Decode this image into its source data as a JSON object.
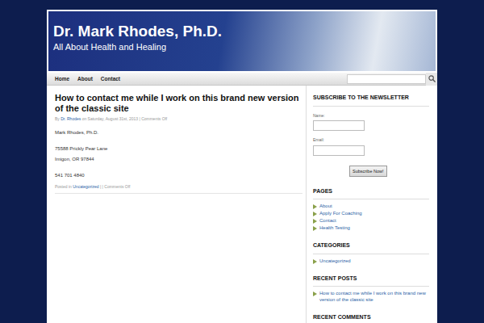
{
  "header": {
    "title": "Dr. Mark Rhodes, Ph.D.",
    "tagline": "All About Health and Healing"
  },
  "nav": {
    "items": [
      {
        "label": "Home"
      },
      {
        "label": "About"
      },
      {
        "label": "Contact"
      }
    ]
  },
  "search": {
    "placeholder": ""
  },
  "post": {
    "title": "How to contact me while I work on this brand new version of the classic site",
    "meta": [
      {
        "text": "By",
        "link": false
      },
      {
        "text": "Dr. Rhodes",
        "link": true
      },
      {
        "text": "on Saturday, August 31st, 2013 |",
        "link": false
      },
      {
        "text": "Comments Off",
        "link": false
      }
    ],
    "paragraphs": [
      [
        "Mark Rhodes, Ph.D."
      ],
      [
        "75588 Prickly Pear Lane",
        "Imigon, OR  97844"
      ],
      [
        "541 701 4840"
      ]
    ],
    "footer": [
      {
        "text": "Posted in",
        "link": false
      },
      {
        "text": "Uncategorized",
        "link": true
      },
      {
        "text": "| | Comments Off",
        "link": false
      }
    ]
  },
  "sidebar": {
    "newsletter": {
      "heading": "SUBSCRIBE TO THE NEWSLETTER",
      "fields": [
        {
          "label": "Name:",
          "value": ""
        },
        {
          "label": "Email:",
          "value": ""
        }
      ],
      "button": "Subscribe Now!"
    },
    "widgets": [
      {
        "heading": "PAGES",
        "items": [
          "About",
          "Apply For Coaching",
          "Contact",
          "Health Testing"
        ]
      },
      {
        "heading": "CATEGORIES",
        "items": [
          "Uncategorized"
        ]
      },
      {
        "heading": "RECENT POSTS",
        "items": [
          "How to contact me while I work on this brand new version of the classic site"
        ]
      },
      {
        "heading": "RECENT COMMENTS",
        "items": []
      }
    ]
  }
}
